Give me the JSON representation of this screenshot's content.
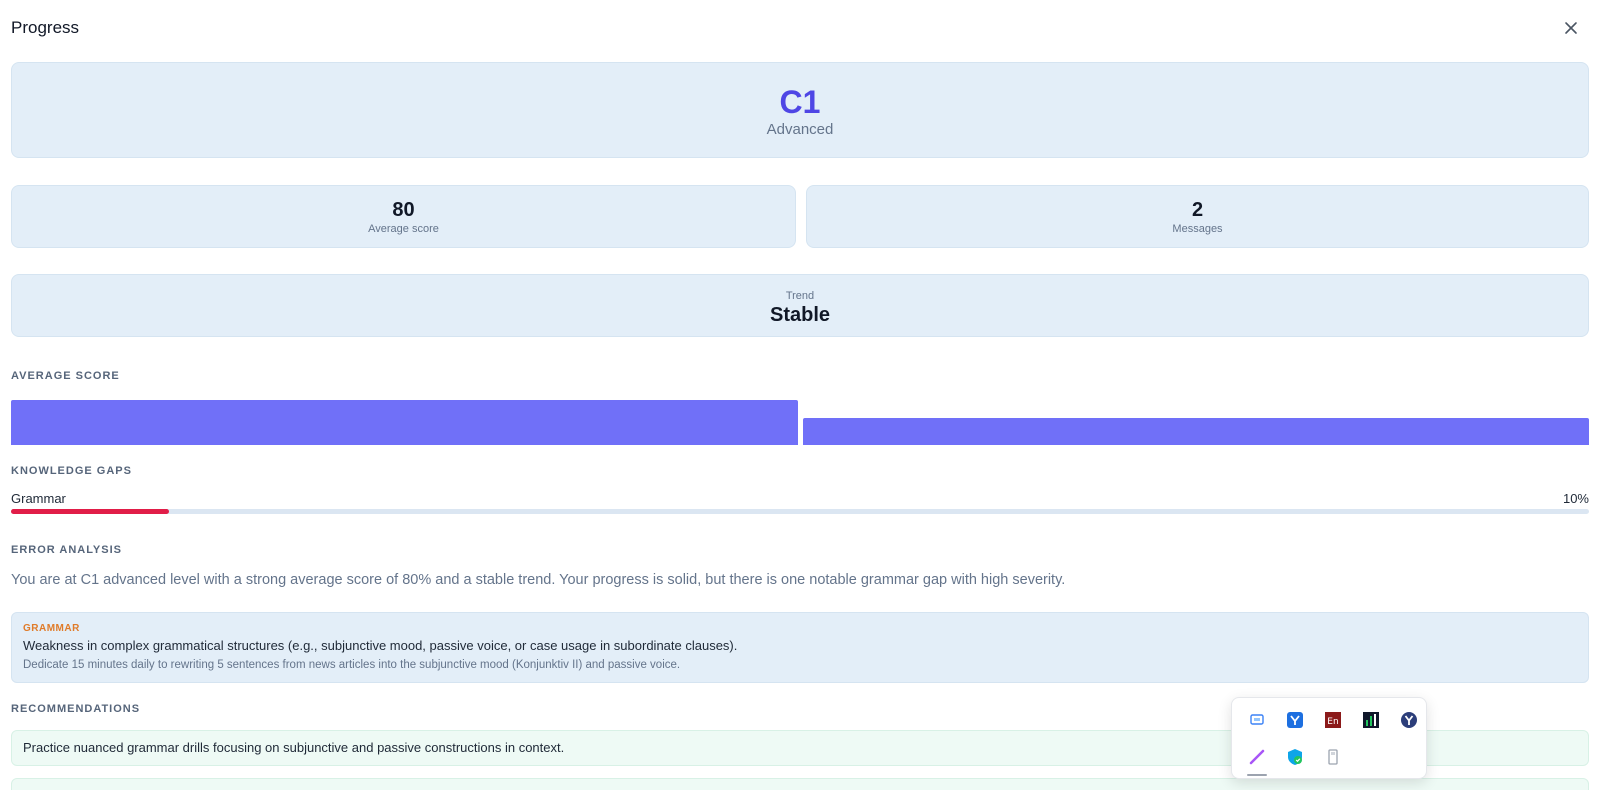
{
  "header": {
    "title": "Progress"
  },
  "level": {
    "code": "C1",
    "name": "Advanced"
  },
  "stats": {
    "average_score": {
      "value": "80",
      "label": "Average score"
    },
    "messages": {
      "value": "2",
      "label": "Messages"
    }
  },
  "trend": {
    "label": "Trend",
    "value": "Stable"
  },
  "sections": {
    "average_score": "AVERAGE SCORE",
    "knowledge_gaps": "KNOWLEDGE GAPS",
    "error_analysis": "ERROR ANALYSIS",
    "recommendations": "RECOMMENDATIONS"
  },
  "knowledge_gaps": [
    {
      "label": "Grammar",
      "percent_text": "10%",
      "percent": 10,
      "color": "#e11d48"
    }
  ],
  "error_analysis": {
    "summary": "You are at C1 advanced level with a strong average score of 80% and a stable trend. Your progress is solid, but there is one notable grammar gap with high severity.",
    "errors": [
      {
        "category": "GRAMMAR",
        "description": "Weakness in complex grammatical structures (e.g., subjunctive mood, passive voice, or case usage in subordinate clauses).",
        "tip": "Dedicate 15 minutes daily to rewriting 5 sentences from news articles into the subjunctive mood (Konjunktiv II) and passive voice."
      }
    ]
  },
  "recommendations": [
    "Practice nuanced grammar drills focusing on subjunctive and passive constructions in context."
  ],
  "chart_data": {
    "type": "bar",
    "categories": [
      "",
      ""
    ],
    "values": [
      100,
      59
    ],
    "bar_color": "#7070f8",
    "title": "",
    "xlabel": "",
    "ylabel": ""
  },
  "tray": {
    "icons": [
      "remote-desktop-icon",
      "yandex-disk-icon",
      "dictionary-en-icon",
      "network-monitor-icon",
      "yandex-browser-icon",
      "pen-icon",
      "windows-security-icon",
      "usb-drive-icon"
    ]
  },
  "colors": {
    "accent": "#4f46e5",
    "card_bg": "#e3eef8",
    "bar": "#7070f8",
    "gap_fill": "#e11d48",
    "category": "#e07b29",
    "rec_bg": "#eefaf5"
  }
}
